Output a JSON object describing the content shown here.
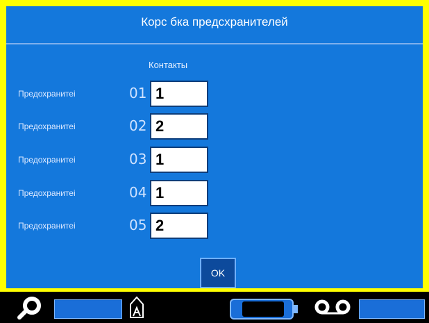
{
  "window": {
    "title": "Корс бка предсхранителей"
  },
  "form": {
    "column_header": "Контакты",
    "rows": [
      {
        "label": "Предохранитеі",
        "index": "01",
        "value": "1"
      },
      {
        "label": "Предохранитеі",
        "index": "02",
        "value": "2"
      },
      {
        "label": "Предохранитеі",
        "index": "03",
        "value": "1"
      },
      {
        "label": "Предохранитеі",
        "index": "04",
        "value": "1"
      },
      {
        "label": "Предохранитеі",
        "index": "05",
        "value": "2"
      }
    ],
    "ok_label": "OK"
  },
  "statusbar": {
    "icons": [
      "search-icon",
      "lock-icon",
      "battery-icon",
      "tape-icon"
    ]
  },
  "colors": {
    "panel": "#1478dc",
    "frame": "#ffff00",
    "statusbar": "#000000",
    "accent": "#1a6ed8"
  }
}
